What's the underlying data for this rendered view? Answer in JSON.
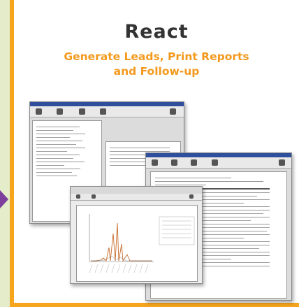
{
  "heading": {
    "title": "React",
    "subtitle_line1": "Generate Leads, Print Reports",
    "subtitle_line2": "and Follow-up"
  },
  "screens": [
    {
      "name": "lead-generation-window"
    },
    {
      "name": "report-window"
    },
    {
      "name": "print-preview-window"
    }
  ],
  "colors": {
    "background": "#e4ecc9",
    "frame": "#f7a51d",
    "subtitle": "#f39a1e",
    "arrow": "#7e3f9c"
  }
}
